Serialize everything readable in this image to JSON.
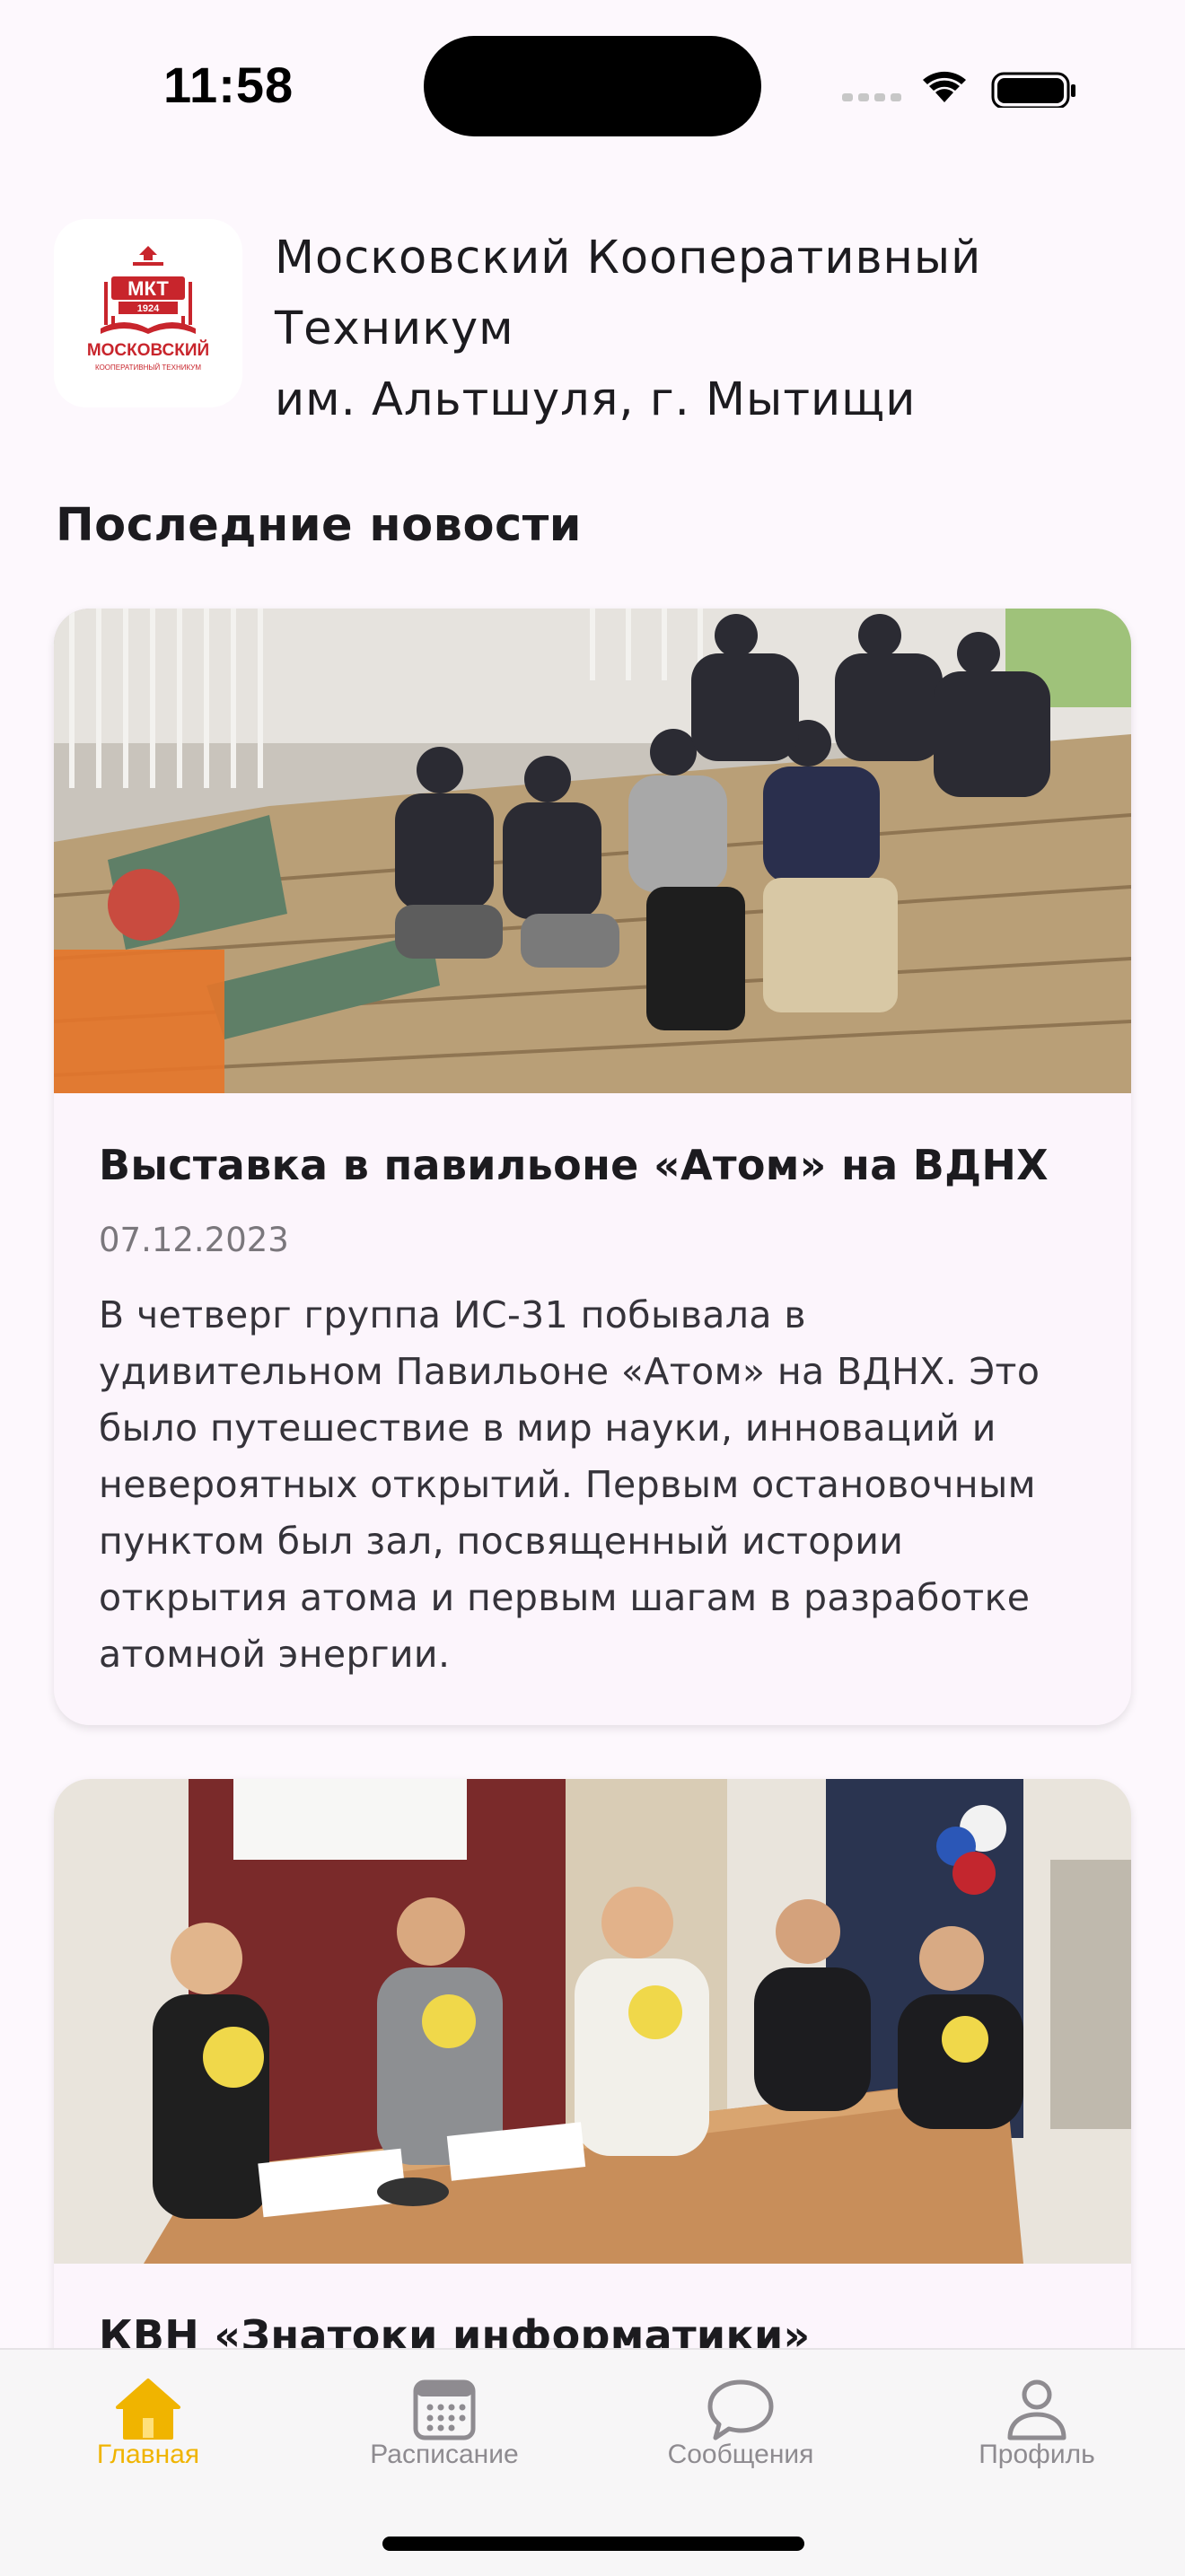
{
  "status_bar": {
    "time": "11:58"
  },
  "header": {
    "logo": {
      "icon": "mkt-logo-icon",
      "lettering": [
        "МКТ",
        "1924",
        "МОСКОВСКИЙ",
        "КООПЕРАТИВНЫЙ ТЕХНИКУМ"
      ]
    },
    "name_lines": [
      "Московский Кооперативный",
      "Техникум",
      "им. Альтшуля, г. Мытищи"
    ]
  },
  "news": {
    "section_title": "Последние новости",
    "items": [
      {
        "title": "Выставка в павильоне «Атом» на ВДНХ",
        "date": "07.12.2023",
        "text_lines": [
          "В четверг группа ИС-31 побывала в",
          "удивительном Павильоне «Атом» на ВДНХ. Это",
          "было путешествие в мир науки, инноваций и",
          "невероятных открытий. Первым остановочным",
          "пунктом был зал, посвященный истории",
          "открытия атома и первым шагам в разработке",
          "атомной энергии."
        ]
      },
      {
        "title": "КВН «Знатоки информатики»"
      }
    ]
  },
  "tab_bar": {
    "tabs": [
      {
        "label": "Главная",
        "icon": "home-icon",
        "active": true
      },
      {
        "label": "Расписание",
        "icon": "calendar-icon",
        "active": false
      },
      {
        "label": "Сообщения",
        "icon": "chat-bubble-icon",
        "active": false
      },
      {
        "label": "Профиль",
        "icon": "person-icon",
        "active": false
      }
    ]
  },
  "colors": {
    "background": "#fdf8fd",
    "accent": "#f0b400",
    "inactive_tab": "#8e8b90",
    "logo_red": "#c8252c"
  }
}
